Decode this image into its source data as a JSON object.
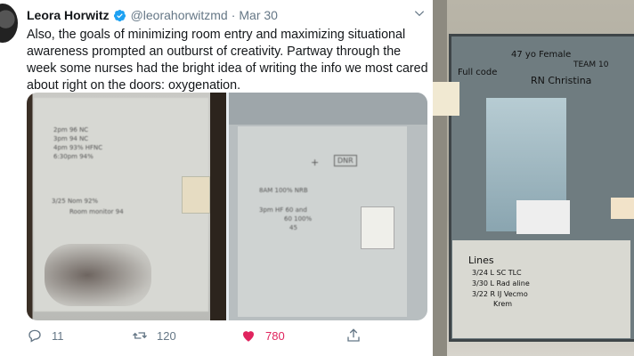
{
  "tweet": {
    "author_name": "Leora Horwitz",
    "handle": "@leorahorwitzmd",
    "separator": "·",
    "date": "Mar 30",
    "text": "Also, the goals of minimizing room entry and maximizing situational awareness prompted an outburst of creativity. Partway through the week some nurses had the bright idea of writing the info we most cared about right on the doors: oxygenation.",
    "replies": "11",
    "retweets": "120",
    "likes": "780",
    "colors": {
      "like": "#e0245e",
      "verified": "#1da1f2",
      "muted": "#657786"
    }
  },
  "photo_left": {
    "lines": [
      "2pm 96 NC",
      "3pm 94 NC",
      "4pm 93% HFNC",
      "6:30pm 94%",
      "3/25 Nom 92%",
      "Room monitor 94"
    ]
  },
  "photo_middle": {
    "labels": [
      "+",
      "DNR"
    ],
    "lines": [
      "8AM 100% NRB",
      "3pm HF 60 and",
      "60 100%",
      "45"
    ]
  },
  "photo_right": {
    "lines": [
      "47 yo Female",
      "TEAM 10",
      "RN Christina",
      "Full code",
      "Lines",
      "3/24 L SC TLC",
      "3/30 L Rad aline",
      "3/22 R IJ Vecmo",
      "Krem"
    ]
  }
}
